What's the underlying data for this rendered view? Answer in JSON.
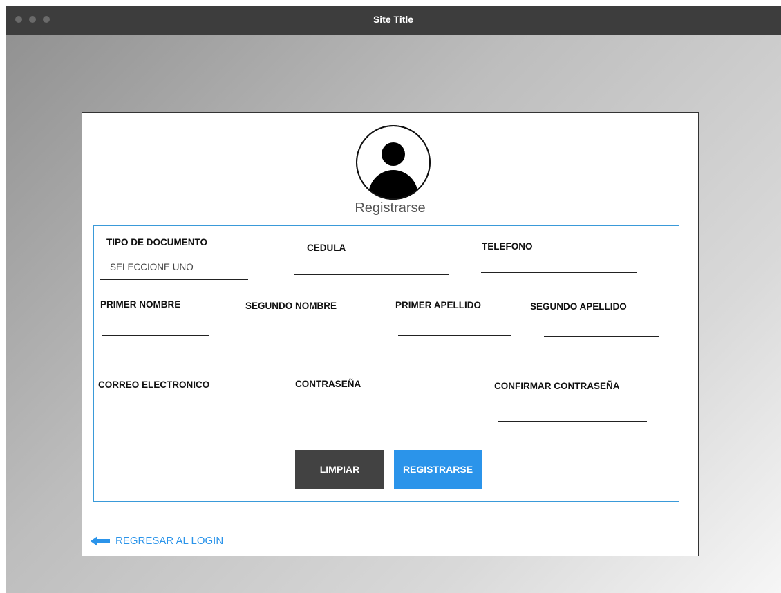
{
  "window": {
    "title": "Site Title"
  },
  "form": {
    "heading": "Registrarse",
    "fields": {
      "tipo_documento": {
        "label": "TIPO DE DOCUMENTO",
        "value": "SELECCIONE UNO"
      },
      "cedula": {
        "label": "CEDULA"
      },
      "telefono": {
        "label": "TELEFONO"
      },
      "primer_nombre": {
        "label": "PRIMER NOMBRE"
      },
      "segundo_nombre": {
        "label": "SEGUNDO NOMBRE"
      },
      "primer_apellido": {
        "label": "PRIMER APELLIDO"
      },
      "segundo_apellido": {
        "label": "SEGUNDO APELLIDO"
      },
      "correo": {
        "label": "CORREO ELECTRONICO"
      },
      "contrasena": {
        "label": "CONTRASEÑA"
      },
      "confirmar": {
        "label": "CONFIRMAR CONTRASEÑA"
      }
    },
    "buttons": {
      "clear": "LIMPIAR",
      "register": "REGISTRARSE"
    }
  },
  "back_link": {
    "label": "REGRESAR AL LOGIN",
    "icon": "arrow-left-icon"
  },
  "colors": {
    "accent": "#2b94ea",
    "dark_button": "#424242",
    "titlebar": "#3d3d3d",
    "form_border": "#3a9ad9"
  }
}
